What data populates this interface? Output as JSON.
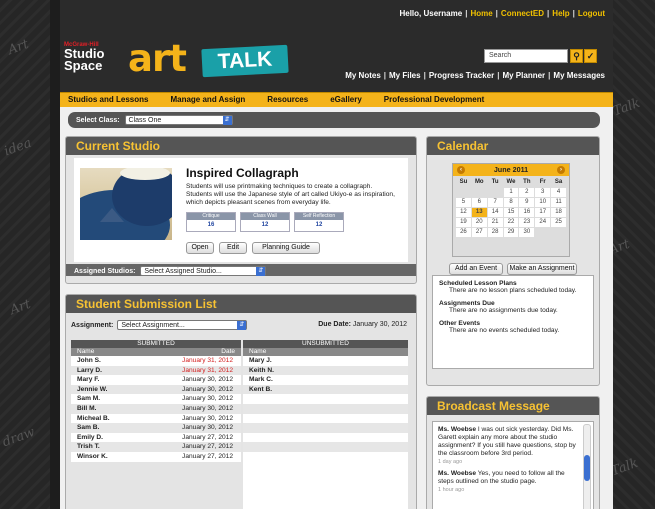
{
  "header": {
    "greeting": "Hello, Username",
    "top_links": [
      "Home",
      "ConnectED",
      "Help",
      "Logout"
    ],
    "logo_publisher": "McGraw-Hill",
    "logo_line1": "Studio",
    "logo_line2": "Space",
    "brand_art": "art",
    "brand_talk": "TALK",
    "search_placeholder": "Search",
    "nav_links": [
      "My Notes",
      "My Files",
      "Progress Tracker",
      "My Planner",
      "My Messages"
    ]
  },
  "menu": [
    "Studios and Lessons",
    "Manage and Assign",
    "Resources",
    "eGallery",
    "Professional Development"
  ],
  "class_select": {
    "label": "Select Class:",
    "value": "Class One"
  },
  "current_studio": {
    "title": "Current Studio",
    "studio_name": "Inspired Collagraph",
    "description": "Students will use printmaking techniques to create a collagraph. Students will use the Japanese style of art called Ukiyo-e as inspiration, which depicts pleasant scenes from everyday life.",
    "stats": [
      {
        "label": "Critique",
        "value": "16"
      },
      {
        "label": "Class Wall",
        "value": "12"
      },
      {
        "label": "Self Reflection",
        "value": "12"
      }
    ],
    "buttons": [
      "Open",
      "Edit",
      "Planning Guide"
    ],
    "assigned_label": "Assigned Studios:",
    "assigned_value": "Select Assigned Studio..."
  },
  "submissions": {
    "title": "Student Submission List",
    "assignment_label": "Assignment:",
    "assignment_value": "Select Assignment...",
    "due_label": "Due Date:",
    "due_value": "January 30, 2012",
    "submitted_header": "SUBMITTED",
    "unsubmitted_header": "UNSUBMITTED",
    "col_name": "Name",
    "col_date": "Date",
    "submitted": [
      {
        "name": "John S.",
        "date": "January 31, 2012",
        "late": true
      },
      {
        "name": "Larry D.",
        "date": "January 31, 2012",
        "late": true
      },
      {
        "name": "Mary F.",
        "date": "January 30, 2012",
        "late": false
      },
      {
        "name": "Jennie W.",
        "date": "January 30, 2012",
        "late": false
      },
      {
        "name": "Sam M.",
        "date": "January 30, 2012",
        "late": false
      },
      {
        "name": "Bill M.",
        "date": "January 30, 2012",
        "late": false
      },
      {
        "name": "Micheal B.",
        "date": "January 30, 2012",
        "late": false
      },
      {
        "name": "Sam B.",
        "date": "January 30, 2012",
        "late": false
      },
      {
        "name": "Emily D.",
        "date": "January 27, 2012",
        "late": false
      },
      {
        "name": "Trish T.",
        "date": "January 27, 2012",
        "late": false
      },
      {
        "name": "Winsor K.",
        "date": "January 27, 2012",
        "late": false
      }
    ],
    "unsubmitted": [
      "Mary J.",
      "Keith N.",
      "Mark C.",
      "Kent B."
    ]
  },
  "calendar": {
    "title": "Calendar",
    "month": "June 2011",
    "days": [
      "Su",
      "Mo",
      "Tu",
      "We",
      "Th",
      "Fr",
      "Sa"
    ],
    "dates": [
      "",
      "",
      "",
      "1",
      "2",
      "3",
      "4",
      "5",
      "6",
      "7",
      "8",
      "9",
      "10",
      "11",
      "12",
      "13",
      "14",
      "15",
      "16",
      "17",
      "18",
      "19",
      "20",
      "21",
      "22",
      "23",
      "24",
      "25",
      "26",
      "27",
      "28",
      "29",
      "30",
      "",
      ""
    ],
    "today": "13",
    "add_event": "Add an Event",
    "make_assignment": "Make an Assignment"
  },
  "events": [
    {
      "heading": "Scheduled Lesson Plans",
      "text": "There are no lesson plans scheduled today."
    },
    {
      "heading": "Assignments Due",
      "text": "There are no assignments due today."
    },
    {
      "heading": "Other Events",
      "text": "There are no events scheduled today."
    }
  ],
  "broadcast": {
    "title": "Broadcast Message",
    "messages": [
      {
        "from": "Ms. Woebse",
        "text": "I was out sick yesterday. Did Ms. Garett explain any more about the studio assignment? If you still have questions, stop by the classroom before 3rd period.",
        "ago": "1 day ago"
      },
      {
        "from": "Ms. Woebse",
        "text": "Yes, you need to follow all the steps outlined on the studio page.",
        "ago": "1 hour ago"
      }
    ]
  },
  "colors": {
    "accent": "#f4b31a",
    "header": "#2b2b2b",
    "teal": "#1aa0a8",
    "late": "#d32020"
  }
}
